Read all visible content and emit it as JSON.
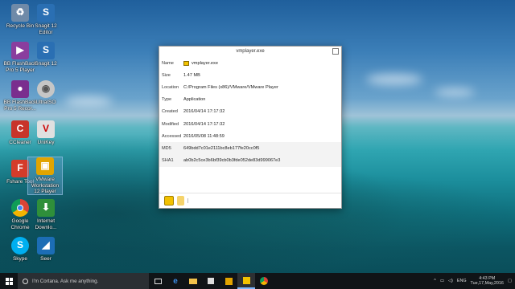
{
  "desktop": {
    "icons": [
      {
        "label": "Recycle Bin",
        "icon": "recycle-bin-icon",
        "color": "#6f8aa8"
      },
      {
        "label": "Snagit 12 Editor",
        "icon": "snagit-editor-icon",
        "color": "#2a6fb3"
      },
      {
        "label": "BB FlashBack Pro 5 Player",
        "icon": "flashback-player-icon",
        "color": "#8a3e9e"
      },
      {
        "label": "Snagit 12",
        "icon": "snagit-icon",
        "color": "#2a6fb3"
      },
      {
        "label": "BB FlashBack Pro 5 Recor...",
        "icon": "flashback-recorder-icon",
        "color": "#7a2e8e"
      },
      {
        "label": "UltraISO",
        "icon": "ultraiso-icon",
        "color": "#c6c6c6"
      },
      {
        "label": "CCleaner",
        "icon": "ccleaner-icon",
        "color": "#c8342a"
      },
      {
        "label": "UniKey",
        "icon": "unikey-icon",
        "color": "#e0e0e0"
      },
      {
        "label": "Fshare Tool",
        "icon": "fshare-tool-icon",
        "color": "#d43c2a"
      },
      {
        "label": "VMware Workstation 12 Player",
        "icon": "vmware-player-icon",
        "color": "#e2a400"
      },
      {
        "label": "Google Chrome",
        "icon": "chrome-icon",
        "color": "#db4437"
      },
      {
        "label": "Internet Downlo...",
        "icon": "internet-download-manager-icon",
        "color": "#2f8f3a"
      },
      {
        "label": "Skype",
        "icon": "skype-icon",
        "color": "#00aff0"
      },
      {
        "label": "Seer",
        "icon": "seer-icon",
        "color": "#1c6db5"
      }
    ]
  },
  "window": {
    "title": "vmplayer.exe",
    "rows": [
      {
        "key": "Name",
        "value": "vmplayer.exe",
        "has_icon": true
      },
      {
        "key": "Size",
        "value": "1.47 MB"
      },
      {
        "key": "Location",
        "value": "C:/Program Files (x86)/VMware/VMware Player"
      },
      {
        "key": "Type",
        "value": "Application"
      },
      {
        "key": "Created",
        "value": "2016/04/14 17:17:32"
      },
      {
        "key": "Modified",
        "value": "2016/04/14 17:17:32"
      },
      {
        "key": "Accessed",
        "value": "2016/05/08 11:48:59"
      },
      {
        "key": "MD5",
        "value": "649bdd7c01e2111bc8eb177fe20cc0f5"
      },
      {
        "key": "SHA1",
        "value": "ab0b2c5ce3b6bf39cb0b3fde052de83d999067e3"
      }
    ]
  },
  "taskbar": {
    "search_placeholder": "I'm Cortana. Ask me anything.",
    "language": "ENG",
    "time": "4:43 PM",
    "date": "Tue,17,May,2016"
  }
}
